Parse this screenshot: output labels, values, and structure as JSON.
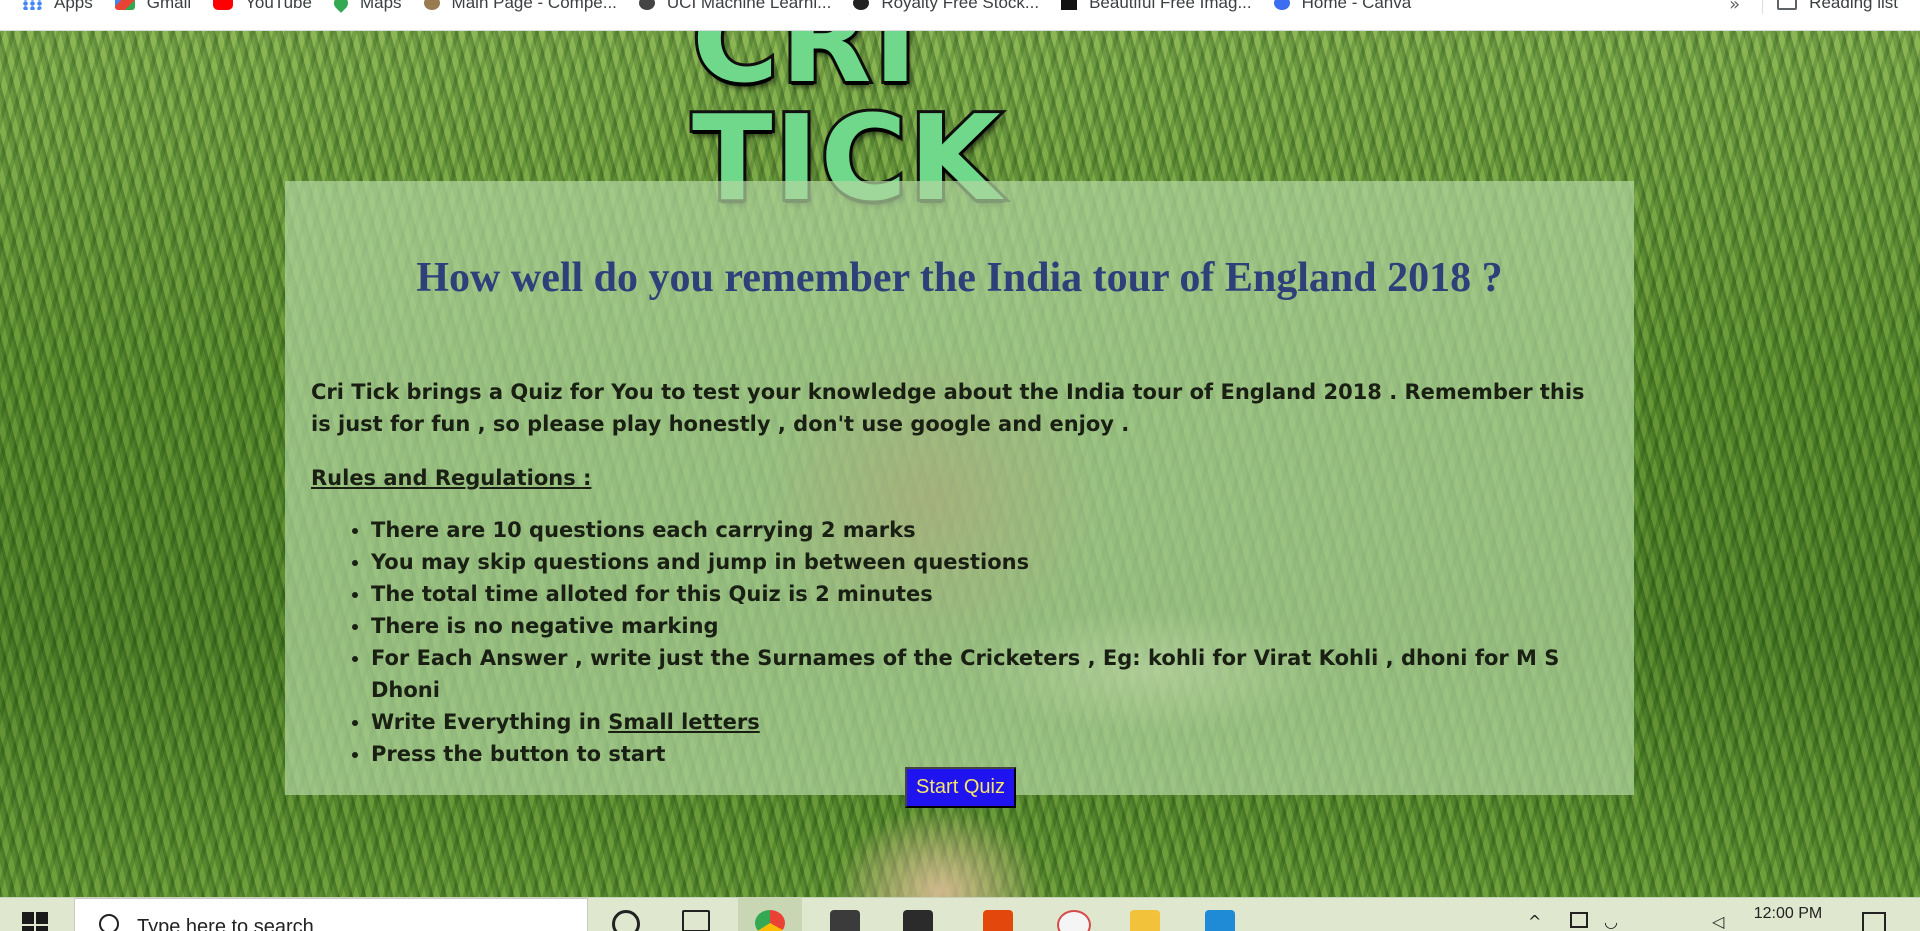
{
  "bookmarks": {
    "items": [
      {
        "label": "Apps",
        "icon": "apps-grid-icon",
        "color": "#4285f4"
      },
      {
        "label": "Gmail",
        "icon": "gmail-icon",
        "color": "#ea4335"
      },
      {
        "label": "YouTube",
        "icon": "youtube-icon",
        "color": "#ff0000"
      },
      {
        "label": "Maps",
        "icon": "maps-icon",
        "color": "#34a853"
      },
      {
        "label": "Main Page - Compe...",
        "icon": "page-favicon-icon",
        "color": "#9a7b4f"
      },
      {
        "label": "UCI Machine Learni...",
        "icon": "uci-favicon-icon",
        "color": "#444444"
      },
      {
        "label": "Royalty Free Stock...",
        "icon": "stock-favicon-icon",
        "color": "#222222"
      },
      {
        "label": "Beautiful Free Imag...",
        "icon": "unsplash-favicon-icon",
        "color": "#111111"
      },
      {
        "label": "Home - Canva",
        "icon": "canva-favicon-icon",
        "color": "#3b6df0"
      }
    ],
    "overflow": "»",
    "reading_list": "Reading list"
  },
  "page": {
    "logo_text": "CRI TICK",
    "title": "How well do you remember the India tour of England 2018 ?",
    "intro": "Cri Tick brings a Quiz for You to test your knowledge about the India tour of England 2018 . Remember this is just for fun , so please play honestly , don't use google and enjoy .",
    "rules_heading": "Rules and Regulations :",
    "rules": [
      "There are 10 questions each carrying 2 marks",
      "You may skip questions and jump in between questions",
      "The total time alloted for this Quiz is 2 minutes",
      "There is no negative marking",
      "For Each Answer , write just the Surnames of the Cricketers , Eg: kohli for Virat Kohli , dhoni for M S Dhoni"
    ],
    "rule_small_prefix": "Write Everything in ",
    "rule_small_link": "Small letters",
    "rule_last": "Press the button to start",
    "start_button": "Start Quiz",
    "colors": {
      "title": "#2e3f7a",
      "button_bg": "#1f14f0",
      "button_text": "#f5e56a",
      "logo": "#6fd88a"
    }
  },
  "taskbar": {
    "search_placeholder": "Type here to search",
    "clock": "12:00 PM",
    "apps": [
      "chrome-icon",
      "sublime-text-icon",
      "store-bag-icon",
      "office-icon",
      "snipping-tool-icon",
      "file-explorer-icon",
      "vscode-icon"
    ]
  }
}
